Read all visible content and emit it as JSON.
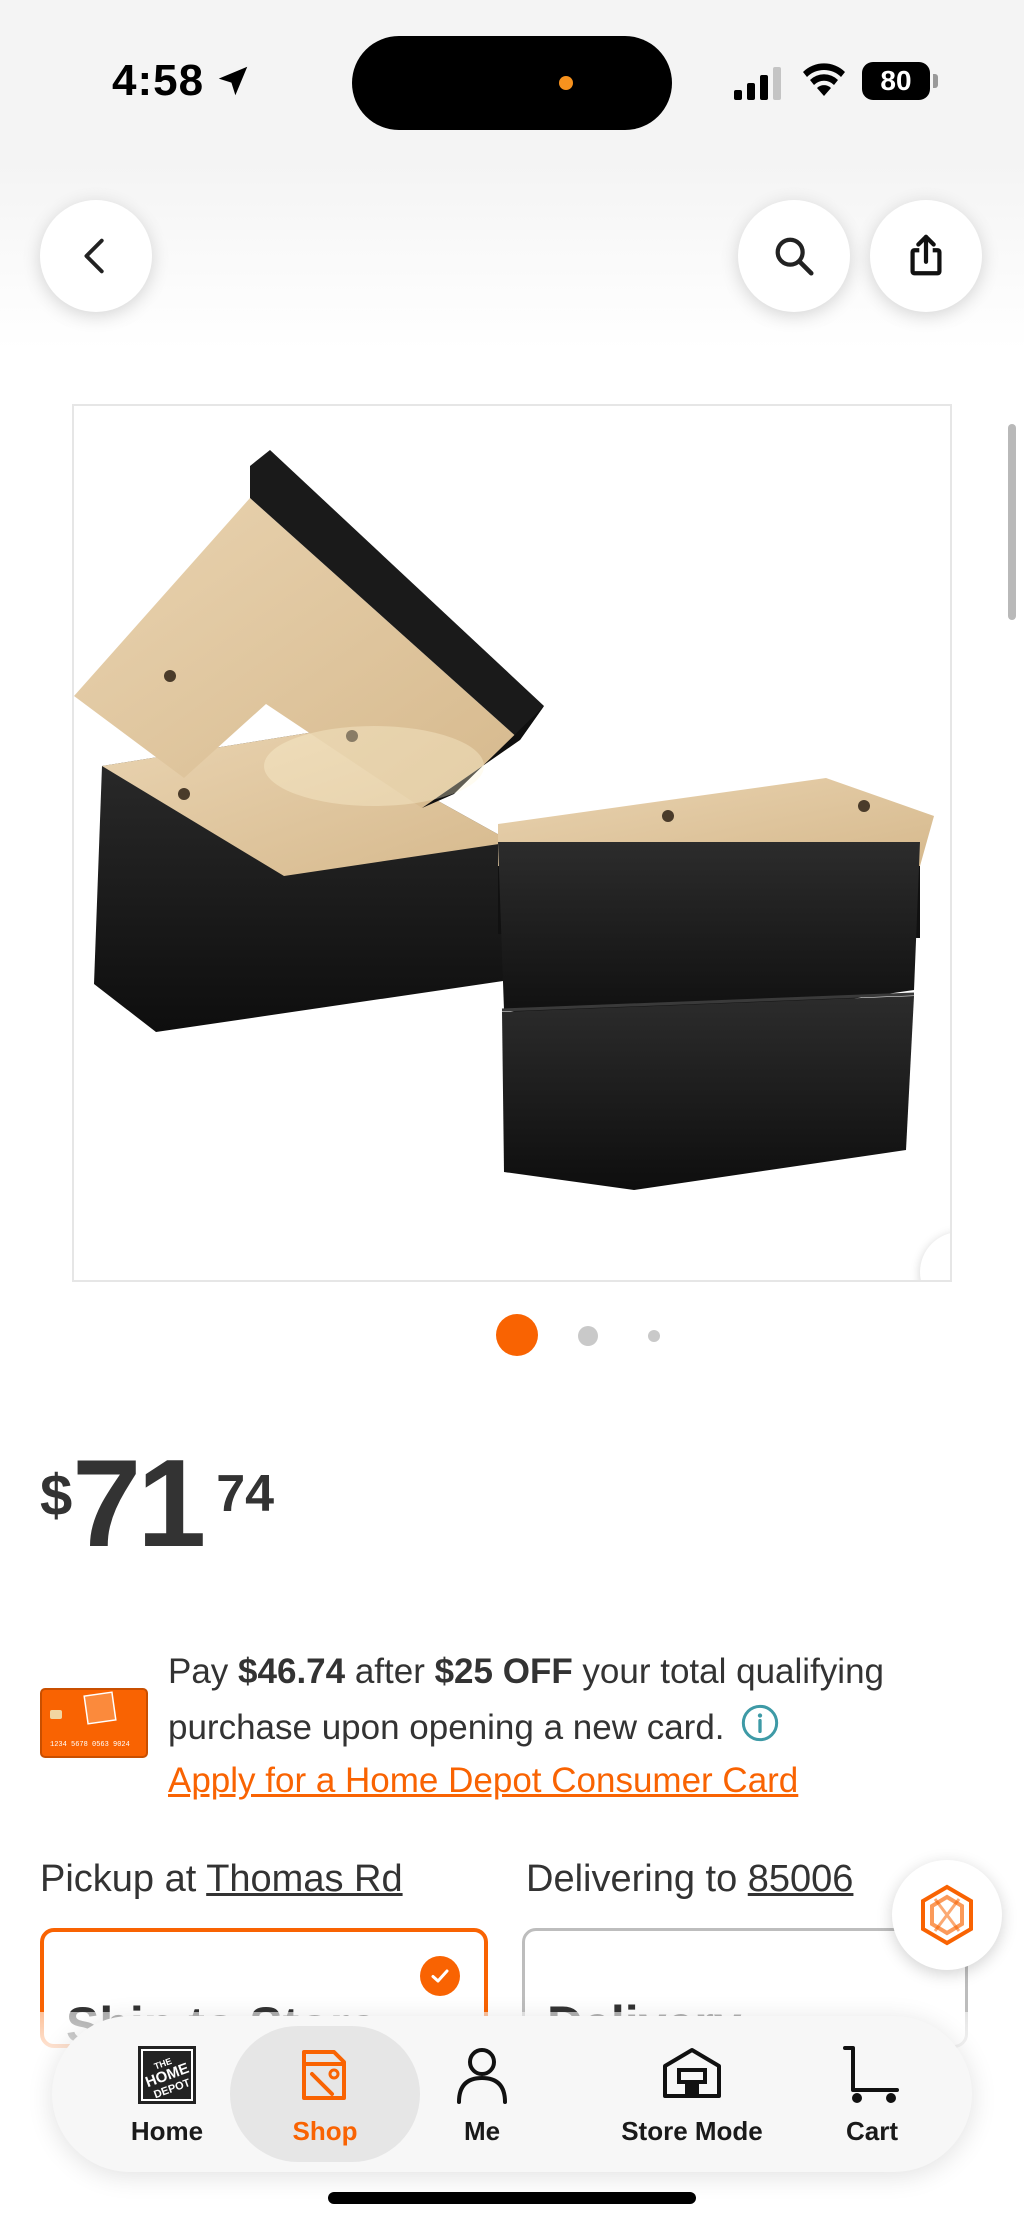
{
  "status_bar": {
    "time": "4:58",
    "battery": "80"
  },
  "top_bar": {
    "back_icon": "chevron-left-icon",
    "search_icon": "search-icon",
    "share_icon": "share-icon"
  },
  "gallery": {
    "image_description_icon": "product-image",
    "next_icon": "chevron-right-icon",
    "total_dots": 3,
    "active_dot": 1,
    "accent_color": "#f96302"
  },
  "price": {
    "currency": "$",
    "dollars": "71",
    "cents": "74"
  },
  "promo": {
    "text_prefix": "Pay ",
    "pay_amount": "$46.74",
    "text_middle": " after ",
    "discount": "$25 OFF",
    "text_suffix": " your total qualifying purchase upon opening a new card.",
    "link": "Apply for a Home Depot Consumer Card",
    "card_number": "1234 5678 0563 9024"
  },
  "fulfillment": {
    "pickup_prefix": "Pickup at ",
    "pickup_store": "Thomas Rd",
    "delivery_prefix": "Delivering to ",
    "delivery_zip": "85006",
    "pickup_option_title": "Ship to Store",
    "delivery_option_title": "Delivery"
  },
  "bottom_nav": {
    "items": [
      {
        "label": "Home",
        "icon": "home-depot-logo-icon"
      },
      {
        "label": "Shop",
        "icon": "shop-icon"
      },
      {
        "label": "Me",
        "icon": "person-icon"
      },
      {
        "label": "Store Mode",
        "icon": "store-icon"
      },
      {
        "label": "Cart",
        "icon": "cart-icon"
      }
    ],
    "active": "Shop"
  }
}
